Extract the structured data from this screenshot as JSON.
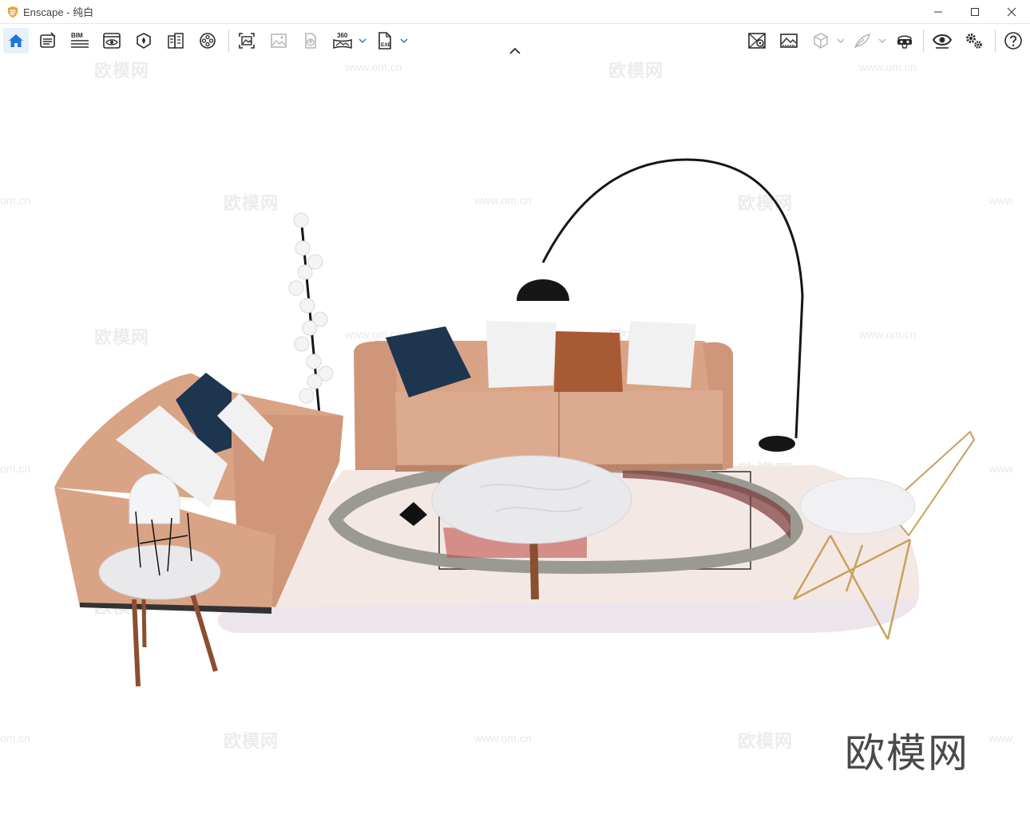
{
  "window": {
    "app_name": "Enscape",
    "separator": " - ",
    "document": "纯白"
  },
  "toolbar": {
    "left_items": [
      {
        "name": "home-button",
        "icon": "home-icon",
        "active": true
      },
      {
        "name": "asset-library-button",
        "icon": "asset-library-icon"
      },
      {
        "name": "bim-button",
        "icon": "bim-icon",
        "label": "BIM"
      },
      {
        "name": "views-button",
        "icon": "eye-panel-icon"
      },
      {
        "name": "material-editor-button",
        "icon": "material-icon"
      },
      {
        "name": "site-context-button",
        "icon": "site-context-icon"
      },
      {
        "name": "video-editor-button",
        "icon": "film-reel-icon"
      },
      {
        "name": "screenshot-button",
        "icon": "screenshot-icon"
      },
      {
        "name": "batch-render-button",
        "icon": "image-icon"
      },
      {
        "name": "upload-button",
        "icon": "upload-icon"
      },
      {
        "name": "panorama-button",
        "icon": "panorama-icon",
        "label": "360"
      },
      {
        "name": "export-exe-button",
        "icon": "exe-file-icon",
        "label": "EXE"
      }
    ],
    "right_items": [
      {
        "name": "capture-button",
        "icon": "map-pin-icon"
      },
      {
        "name": "visual-settings-button",
        "icon": "landscape-icon"
      },
      {
        "name": "cube-button",
        "icon": "cube-icon"
      },
      {
        "name": "feather-button",
        "icon": "feather-icon"
      },
      {
        "name": "vr-headset-button",
        "icon": "vr-headset-icon"
      },
      {
        "name": "live-view-button",
        "icon": "eye-icon"
      },
      {
        "name": "settings-button",
        "icon": "gears-icon"
      },
      {
        "name": "help-button",
        "icon": "help-icon"
      }
    ]
  },
  "colors": {
    "accent": "#1e78d6",
    "icon": "#2b2b2b",
    "icon_disabled": "#b5b5b5",
    "sofa": "#d9a386",
    "sofa_shadow": "#b98469",
    "pillow_navy": "#1e3550",
    "pillow_white": "#f1f1f1",
    "pillow_leather": "#a75a33",
    "rug": "#f4e8e4",
    "marble": "#e9e9ec",
    "wood": "#8b4e2e",
    "brass": "#c8a15e",
    "lamp_black": "#161616",
    "logo_orange": "#f0a030"
  },
  "watermarks": {
    "brand": "欧模网",
    "url": "www.om.cn",
    "url_partial": "om.cn",
    "url_fragment": "www."
  }
}
